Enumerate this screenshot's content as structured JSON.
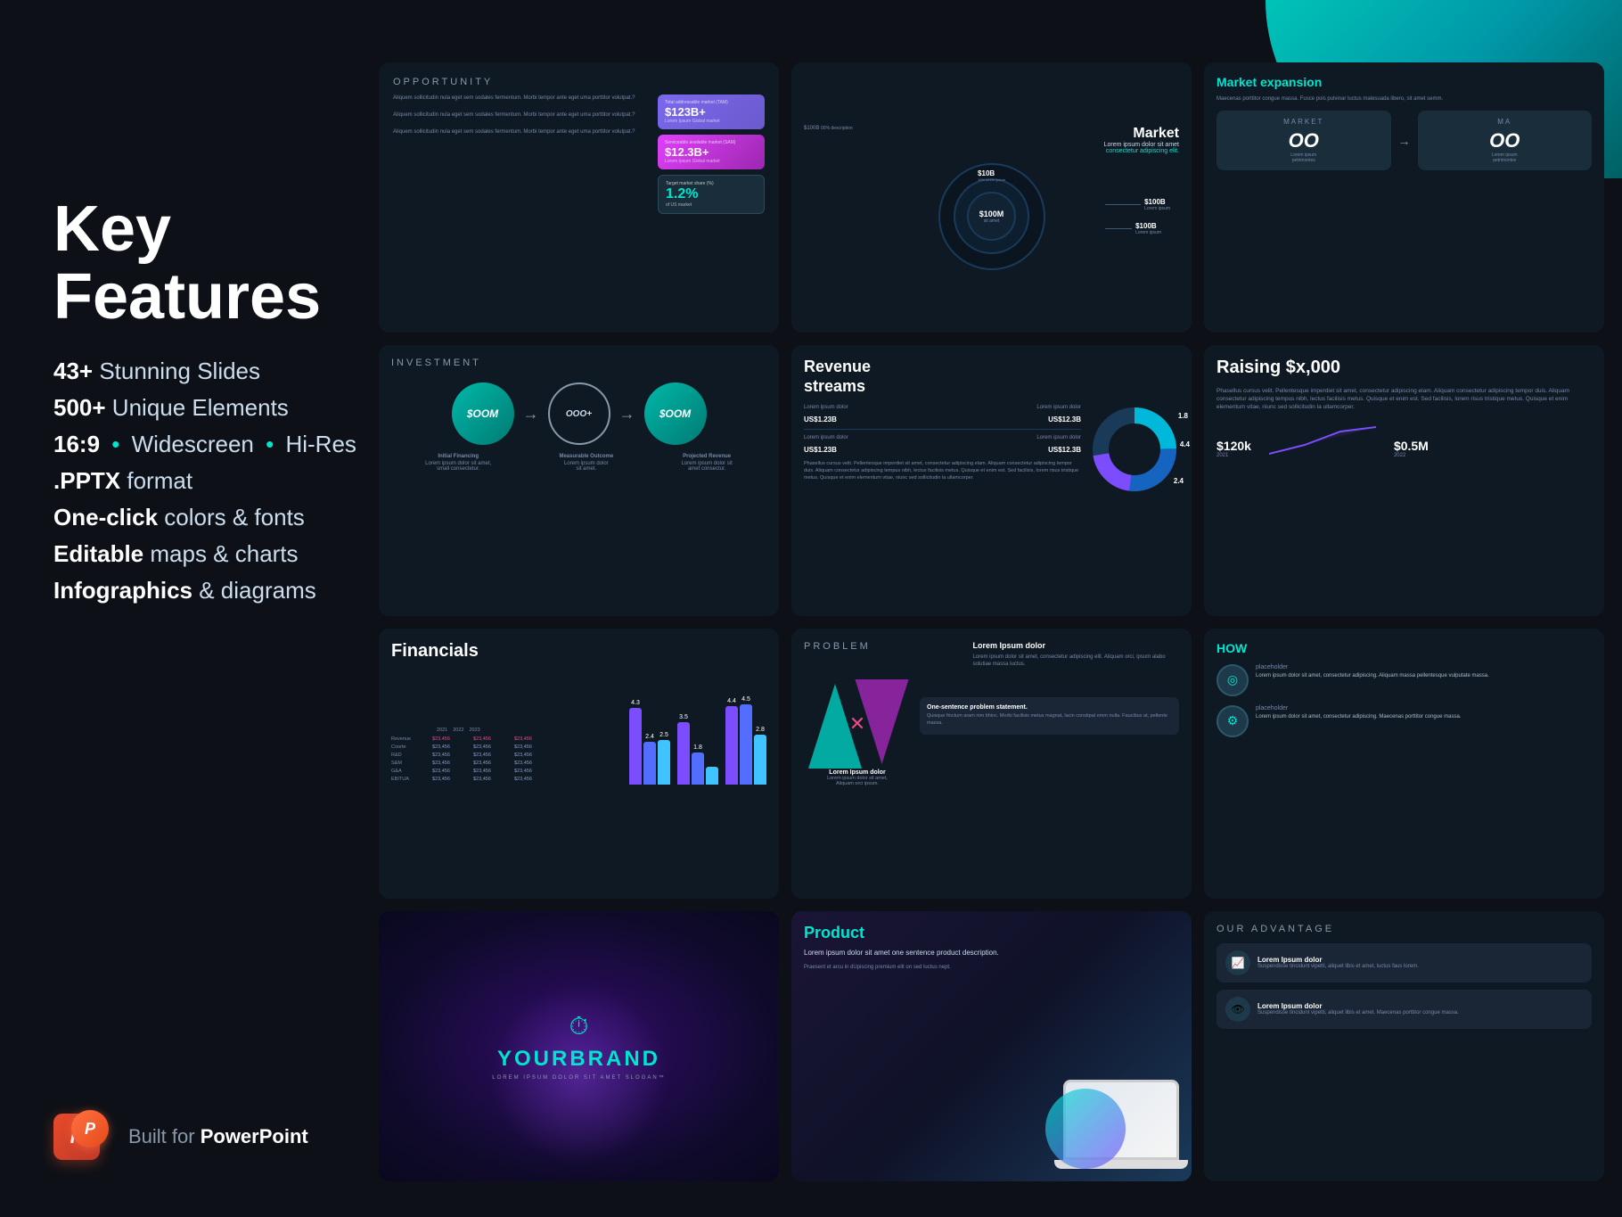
{
  "background": "#0d1117",
  "teal_corner": {
    "color": "#00c4b8"
  },
  "left_panel": {
    "title_line1": "Key",
    "title_line2": "Features",
    "features": [
      {
        "bold": "43+",
        "text": " Stunning Slides"
      },
      {
        "bold": "500+",
        "text": " Unique Elements"
      },
      {
        "bold": "16:9",
        "bullet": "•",
        "mid": "Widescreen",
        "bullet2": "•",
        "text": "Hi-Res"
      },
      {
        "bold": ".PPTX",
        "text": " format"
      },
      {
        "bold": "One-click",
        "text": " colors & fonts"
      },
      {
        "bold": "Editable",
        "text": " maps & charts"
      },
      {
        "bold": "Infographics",
        "text": " & diagrams"
      }
    ]
  },
  "bottom_logo": {
    "icon_letter": "P",
    "built_for_prefix": "Built for ",
    "built_for_brand": "PowerPoint"
  },
  "slides": [
    {
      "id": "opportunity",
      "type": "opportunity",
      "header": "OPPORTUNITY",
      "tam_label": "Total addressable market (TAM)",
      "tam_value": "$123B+",
      "tam_sub": "Lorem Ipsum Global market",
      "sam_label": "Serviceable available market (SAM)",
      "sam_value": "$12.3B+",
      "sam_sub": "Lorem Ipsum Global market",
      "share_label": "Target market share (%)",
      "share_value": "1.2%",
      "share_sub": "of US market"
    },
    {
      "id": "market",
      "type": "market",
      "title": "Market",
      "subtitle": "Lorem ipsum dolor sit amet",
      "subtitle2": "consectetur adipiscing elit.",
      "values": [
        {
          "label": "$100B",
          "sub": "00% description"
        },
        {
          "label": "$10B",
          "sub": "10% lorem ipsum"
        },
        {
          "label": "$100M",
          "sub": "sit amet"
        },
        {
          "label": "$100B",
          "sub": "Lorem ipsum"
        },
        {
          "label": "$100B",
          "sub": "Lorem ipsum"
        }
      ]
    },
    {
      "id": "market-expansion",
      "type": "market-expansion",
      "title": "Market expansion",
      "market_label": "MARKET",
      "values": [
        "OO",
        "OO"
      ]
    },
    {
      "id": "investment",
      "type": "investment",
      "header": "INVESTMENT",
      "nodes": [
        {
          "label": "$OOM",
          "sub": "Initial Financing"
        },
        {
          "label": "OOO+",
          "sub": "Measurable Outcome"
        },
        {
          "label": "$OOM",
          "sub": "Projected Revenue"
        }
      ]
    },
    {
      "id": "revenue-streams",
      "type": "revenue",
      "title": "Revenue\nstreams",
      "rows": [
        {
          "label": "Lorem ipsum dolor",
          "val1": "Lorem ipsum dolor",
          "v1": "US$1.23B",
          "v2": "US$12.3B"
        },
        {
          "label": "Lorem ipsum dolor",
          "val2": "Lorem ipsum dolor",
          "v1": "US$1.23B",
          "v2": "US$12.3B"
        }
      ],
      "donut_segments": [
        {
          "value": 4.4,
          "color": "#00b8d9"
        },
        {
          "value": 2.4,
          "color": "#1565c0"
        },
        {
          "value": 1.8,
          "color": "#7c4dff"
        }
      ]
    },
    {
      "id": "raising",
      "type": "raising",
      "title": "Raising $x,000",
      "values": [
        {
          "label": "$120k",
          "year": "2021"
        },
        {
          "label": "$0.5M",
          "year": "2022"
        }
      ]
    },
    {
      "id": "financials",
      "type": "financials",
      "title": "Financials",
      "columns": [
        "2021",
        "2022",
        "2023"
      ],
      "rows": [
        {
          "label": "Revenue",
          "vals": [
            "$23,456",
            "$23,456",
            "$23,456"
          ],
          "highlight": true
        },
        {
          "label": "Coorte",
          "vals": [
            "$23,456",
            "$23,456",
            "$23,456"
          ]
        },
        {
          "label": "R&D",
          "vals": [
            "$23,456",
            "$23,456",
            "$23,456"
          ]
        },
        {
          "label": "S&M",
          "vals": [
            "$23,456",
            "$23,456",
            "$23,456"
          ]
        },
        {
          "label": "G&A",
          "vals": [
            "$23,456",
            "$23,456",
            "$23,456"
          ]
        },
        {
          "label": "EBITUA",
          "vals": [
            "$23,456",
            "$23,456",
            "$23,456"
          ]
        }
      ],
      "bars": [
        {
          "year": "2021",
          "groups": [
            {
              "val": 4.3,
              "color": "#7c4dff"
            },
            {
              "val": 2.4,
              "color": "#536dfe"
            },
            {
              "val": 2.5,
              "color": "#40c4ff"
            }
          ]
        },
        {
          "year": "2022",
          "groups": [
            {
              "val": 3.5,
              "color": "#7c4dff"
            },
            {
              "val": 1.8,
              "color": "#536dfe"
            },
            {
              "val": 1.0,
              "color": "#40c4ff"
            }
          ]
        },
        {
          "year": "2023",
          "groups": [
            {
              "val": 4.4,
              "color": "#7c4dff"
            },
            {
              "val": 4.5,
              "color": "#536dfe"
            },
            {
              "val": 2.8,
              "color": "#40c4ff"
            }
          ]
        }
      ]
    },
    {
      "id": "problem",
      "type": "problem",
      "header": "PROBLEM",
      "box_title": "Lorem Ipsum dolor",
      "box_text": "Lorem ipsum dolor sit amet, consectetur adipiscing elit. Aliquam orci, ipsum alabo solutiae massa luctus.",
      "arrow_title": "Lorem Ipsum dolor",
      "arrow_text": "Lorem ipsum dolor sit amet, Aliquam orci, ipsum alabo solutiae.",
      "statement": "One-sentence problem statement.",
      "statement_detail": "Quisque finctum aram nim bhinc. Morbi facilisis metus magnat, lacin constipat emm nulla. Faucibus at, pellente massa."
    },
    {
      "id": "how",
      "type": "how",
      "title": "HOW",
      "items": [
        {
          "icon": "◎",
          "label": "placeholder",
          "text": "Lorem ipsum dolor sit amet, consectetur adipiscing. Aliquam massa pellentesque vulputate massa."
        },
        {
          "icon": "⚙",
          "label": "placeholder",
          "text": "Lorem ipsum dolor sit amet, consectetur adipiscing. Maecenas porttitor congue massa."
        }
      ]
    },
    {
      "id": "brand",
      "type": "brand",
      "icon": "⏱",
      "name": "YOURBRAND",
      "slogan": "LOREM IPSUM DOLOR SIT AMET SLOGAN™"
    },
    {
      "id": "product",
      "type": "product",
      "title": "Product",
      "text": "Lorem ipsum dolor sit amet one sentence product description.",
      "detail": "Praesent et arcu in dUpiscing premium elit on sed luctus nept."
    },
    {
      "id": "advantage",
      "type": "advantage",
      "header": "OUR ADVANTAGE",
      "items": [
        {
          "icon": "📈",
          "title": "Lorem Ipsum dolor",
          "text": "Suspendisse tincidunt vipetti, aliquet libis et amet, luctus faus lorem."
        },
        {
          "icon": "👁",
          "title": "Lorem Ipsum dolor",
          "text": "Suspendisse tincidunt vipetti, aliquet libis et amet. Maecenas porttitor congue massa."
        }
      ]
    }
  ]
}
